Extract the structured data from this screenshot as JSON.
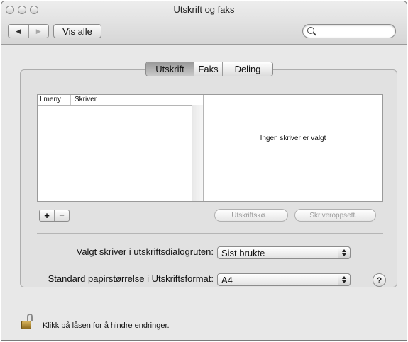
{
  "window": {
    "title": "Utskrift og faks"
  },
  "toolbar": {
    "back_icon": "back-arrow-icon",
    "forward_icon": "forward-arrow-icon",
    "show_all_label": "Vis alle",
    "search_placeholder": "",
    "search_value": ""
  },
  "tabs": [
    {
      "label": "Utskrift",
      "active": true
    },
    {
      "label": "Faks",
      "active": false
    },
    {
      "label": "Deling",
      "active": false
    }
  ],
  "printer_list": {
    "columns": [
      "I meny",
      "Skriver"
    ],
    "rows": [],
    "empty_message": "Ingen skriver er valgt"
  },
  "list_controls": {
    "add_label": "+",
    "remove_label": "−",
    "print_queue_label": "Utskriftskø...",
    "printer_setup_label": "Skriveroppsett..."
  },
  "settings": {
    "selected_printer_label": "Valgt skriver i utskriftsdialogruten:",
    "selected_printer_value": "Sist brukte",
    "paper_size_label": "Standard papirstørrelse i Utskriftsformat:",
    "paper_size_value": "A4",
    "help_label": "?"
  },
  "footer": {
    "lock_icon": "lock-open-icon",
    "lock_text": "Klikk på låsen for å hindre endringer."
  }
}
